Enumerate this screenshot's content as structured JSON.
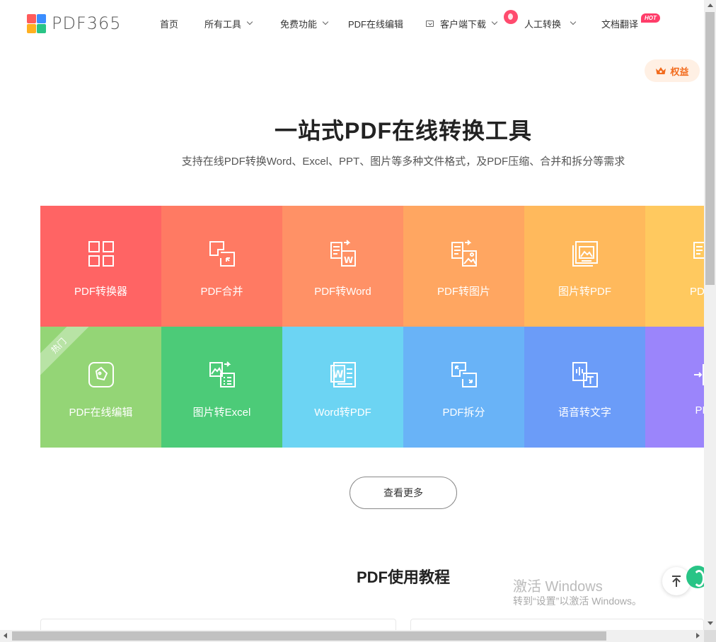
{
  "logo": {
    "text": "PDF365",
    "colors": [
      "#ff5b5b",
      "#3a8dff",
      "#ffb020",
      "#29c486"
    ]
  },
  "nav": {
    "items": [
      {
        "label": "首页",
        "dropdown": false
      },
      {
        "label": "所有工具",
        "dropdown": true
      },
      {
        "label": "免费功能",
        "dropdown": true
      },
      {
        "label": "PDF在线编辑",
        "dropdown": false
      },
      {
        "label": "客户端下载",
        "dropdown": true
      },
      {
        "label": "人工转换",
        "dropdown": true
      },
      {
        "label": "文档翻译",
        "dropdown": false
      }
    ],
    "hot_badge": "HOT"
  },
  "benefit": {
    "label": "权益",
    "color": "#f26b1d"
  },
  "hero": {
    "title": "一站式PDF在线转换工具",
    "subtitle": "支持在线PDF转换Word、Excel、PPT、图片等多种文件格式，及PDF压缩、合并和拆分等需求"
  },
  "tools": [
    {
      "label": "PDF转换器",
      "icon": "grid-icon",
      "color": "#ff6464"
    },
    {
      "label": "PDF合并",
      "icon": "merge-icon",
      "color": "#ff7a63"
    },
    {
      "label": "PDF转Word",
      "icon": "pdf-to-word-icon",
      "color": "#ff9166"
    },
    {
      "label": "PDF转图片",
      "icon": "pdf-to-image-icon",
      "color": "#ffa661"
    },
    {
      "label": "图片转PDF",
      "icon": "image-to-pdf-icon",
      "color": "#ffb95c"
    },
    {
      "label": "PDF转",
      "icon": "pdf-to-ppt-icon",
      "color": "#ffc95f"
    },
    {
      "label": "PDF在线编辑",
      "icon": "edit-icon",
      "color": "#94d576",
      "ribbon": "热门"
    },
    {
      "label": "图片转Excel",
      "icon": "image-to-excel-icon",
      "color": "#4ccb78"
    },
    {
      "label": "Word转PDF",
      "icon": "word-to-pdf-icon",
      "color": "#6cd4f3"
    },
    {
      "label": "PDF拆分",
      "icon": "split-icon",
      "color": "#69b3f7"
    },
    {
      "label": "语音转文字",
      "icon": "speech-to-text-icon",
      "color": "#6b9cf8"
    },
    {
      "label": "PDF",
      "icon": "pdf-insert-icon",
      "color": "#9b85fb"
    }
  ],
  "more_button": "查看更多",
  "tutorial_title": "PDF使用教程",
  "watermark": {
    "line1": "激活 Windows",
    "line2": "转到“设置”以激活 Windows。"
  }
}
